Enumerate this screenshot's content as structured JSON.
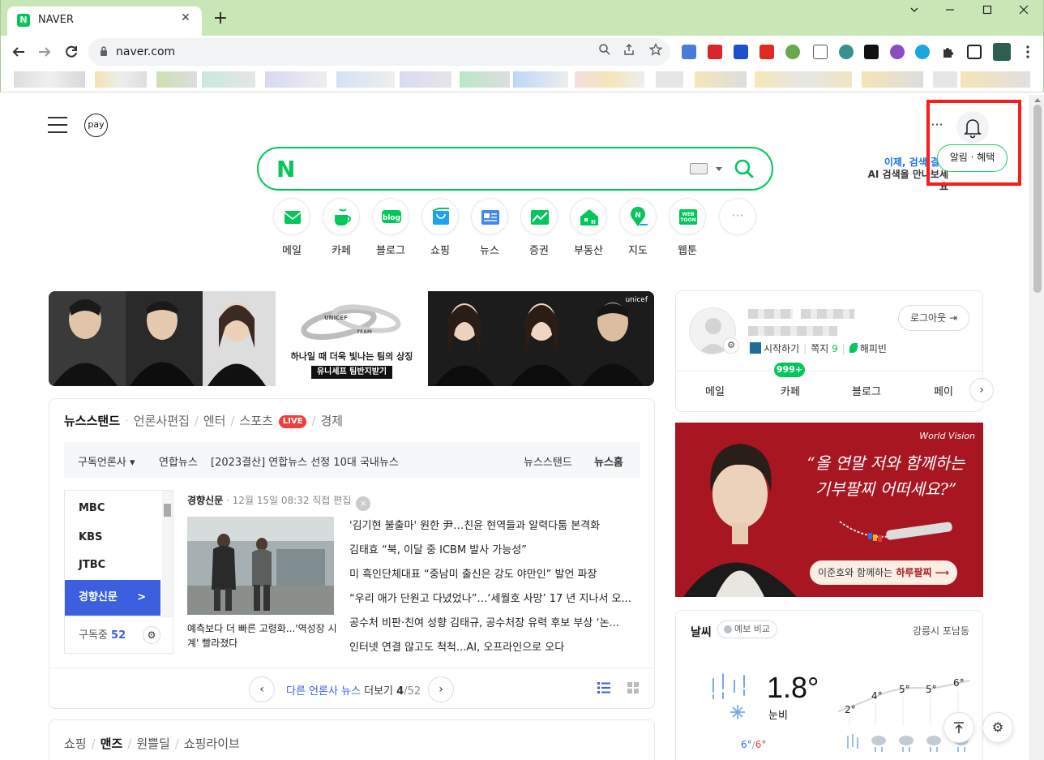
{
  "browser": {
    "tab_title": "NAVER",
    "tab_favicon_letter": "N",
    "url": "naver.com",
    "new_tab_symbol": "+",
    "close_symbol": "✕"
  },
  "header": {
    "pay_label": "pay",
    "more_symbol": "···",
    "bell_tooltip": "알림 · 혜택",
    "ai_promo_line1": "이제, 검색 결과",
    "ai_promo_line2": "AI 검색을 만나보세요"
  },
  "search": {
    "logo_letter": "N",
    "query": ""
  },
  "shortcuts": [
    {
      "label": "메일",
      "icon": "mail-icon"
    },
    {
      "label": "카페",
      "icon": "cafe-icon"
    },
    {
      "label": "블로그",
      "icon": "blog-icon"
    },
    {
      "label": "쇼핑",
      "icon": "shopping-icon"
    },
    {
      "label": "뉴스",
      "icon": "news-icon"
    },
    {
      "label": "증권",
      "icon": "stock-icon"
    },
    {
      "label": "부동산",
      "icon": "realestate-icon"
    },
    {
      "label": "지도",
      "icon": "map-icon"
    },
    {
      "label": "웹툰",
      "icon": "webtoon-icon"
    },
    {
      "label": "",
      "icon": "more-icon"
    }
  ],
  "banner": {
    "caption": "하나일 때 더욱 빛나는 팀의 상징",
    "button": "유니세프 팀반지받기",
    "brand": "unicef",
    "ring_text_1": "UNICEF",
    "ring_text_2": "TEAM"
  },
  "newsstand": {
    "tabs": [
      "뉴스스탠드",
      "언론사편집",
      "엔터",
      "스포츠",
      "경제"
    ],
    "live_label": "LIVE",
    "subscribed_dropdown": "구독언론사",
    "ticker_source": "연합뉴스",
    "ticker_headline": "[2023결산] 연합뉴스 선정 10대 국내뉴스",
    "link_newsstand": "뉴스스탠드",
    "link_newshome": "뉴스홈",
    "press": [
      "MBC",
      "KBS",
      "JTBC",
      "경향신문"
    ],
    "active_press_arrow": ">",
    "subscribed_label": "구독중",
    "subscribed_count": "52",
    "publisher": "경향신문",
    "publish_time": "12월 15일 08:32 직접 편집",
    "photo_caption": "예측보다 더 빠른 고령화...'역성장 시계' 빨라졌다",
    "headlines": [
      "'김기현 불출마' 원한 尹…친윤 현역들과 알력다툼 본격화",
      "김태효 “북, 이달 중 ICBM 발사 가능성”",
      "미 흑인단체대표 “중남미 출신은 강도 야만인” 발언 파장",
      "“우리 애가 단원고 다녔었나”…‘세월호 사망’ 17 년 지나서 오...",
      "공수처 비판·친여 성향 김태규, 공수처장 유력 후보 부상 ‘논...",
      "인터넷 연결 않고도 척척...AI, 오프라인으로 오다"
    ],
    "pager_prefix": "다른 언론사 뉴스",
    "pager_more": "더보기",
    "pager_current": "4",
    "pager_total": "/52"
  },
  "shopping": {
    "tabs": [
      "쇼핑",
      "맨즈",
      "원쁠딜",
      "쇼핑라이브"
    ]
  },
  "account": {
    "logout_label": "로그아웃",
    "start_label": "시작하기",
    "note_label": "쪽지",
    "note_count": "9",
    "happybean_label": "해피빈",
    "cafe_badge": "999+",
    "services": [
      "메일",
      "카페",
      "블로그",
      "페이"
    ]
  },
  "ad": {
    "brand": "World Vision",
    "copy_line1": "“올 연말 저와 함께하는",
    "copy_line2": "기부팔찌 어떠세요?”",
    "button_dark": "이준호와 함께하는",
    "button_red": "하루팔찌",
    "button_arrow": "⟶"
  },
  "weather": {
    "title": "날씨",
    "forecast_pill": "예보 비교",
    "location": "강릉시 포남동",
    "temperature": "1.8°",
    "condition": "눈비",
    "low": "6°",
    "high": "6°",
    "hourly": [
      "2°",
      "4°",
      "5°",
      "5°",
      "6°"
    ]
  }
}
